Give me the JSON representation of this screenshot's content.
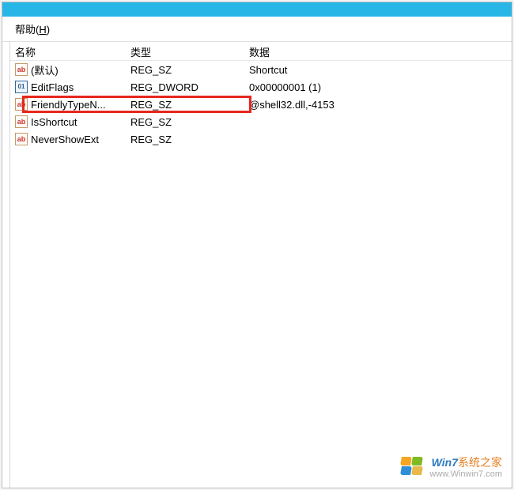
{
  "menu": {
    "help_label": "帮助",
    "help_hotkey": "H"
  },
  "columns": {
    "name": "名称",
    "type": "类型",
    "data": "数据"
  },
  "rows": [
    {
      "icon": "ab",
      "name": "(默认)",
      "type": "REG_SZ",
      "data": "Shortcut"
    },
    {
      "icon": "bin",
      "name": "EditFlags",
      "type": "REG_DWORD",
      "data": "0x00000001 (1)"
    },
    {
      "icon": "ab",
      "name": "FriendlyTypeN...",
      "type": "REG_SZ",
      "data": "@shell32.dll,-4153"
    },
    {
      "icon": "ab",
      "name": "IsShortcut",
      "type": "REG_SZ",
      "data": ""
    },
    {
      "icon": "ab",
      "name": "NeverShowExt",
      "type": "REG_SZ",
      "data": ""
    }
  ],
  "highlighted_row_index": 3,
  "watermark": {
    "brand_prefix": "Win7",
    "brand_rest": "系统之家",
    "url": "www.Winwin7.com"
  }
}
